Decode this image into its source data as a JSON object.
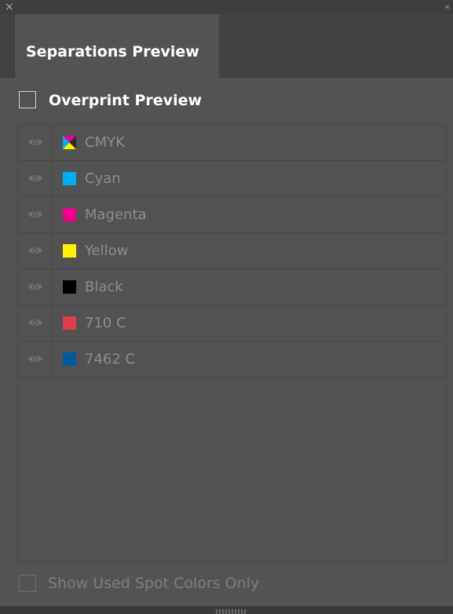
{
  "titlebar": {
    "close_glyph": "×",
    "collapse_glyph": "‹‹"
  },
  "tab": {
    "label": "Separations Preview"
  },
  "overprint": {
    "label": "Overprint Preview",
    "checked": false
  },
  "separations": [
    {
      "label": "CMYK",
      "swatch": "cmyk-icon",
      "visible": true
    },
    {
      "label": "Cyan",
      "swatch_color": "#00aeef",
      "visible": true
    },
    {
      "label": "Magenta",
      "swatch_color": "#ec008c",
      "visible": true
    },
    {
      "label": "Yellow",
      "swatch_color": "#fff200",
      "visible": true
    },
    {
      "label": "Black",
      "swatch_color": "#000000",
      "visible": true
    },
    {
      "label": "710 C",
      "swatch_color": "#e03c4b",
      "visible": true
    },
    {
      "label": "7462 C",
      "swatch_color": "#005a9c",
      "visible": true
    }
  ],
  "footer": {
    "label": "Show Used Spot Colors Only",
    "checked": false
  },
  "colors": {
    "panel_bg": "#535353",
    "label_dim": "#8d8d8d",
    "text_bright": "#ffffff"
  }
}
